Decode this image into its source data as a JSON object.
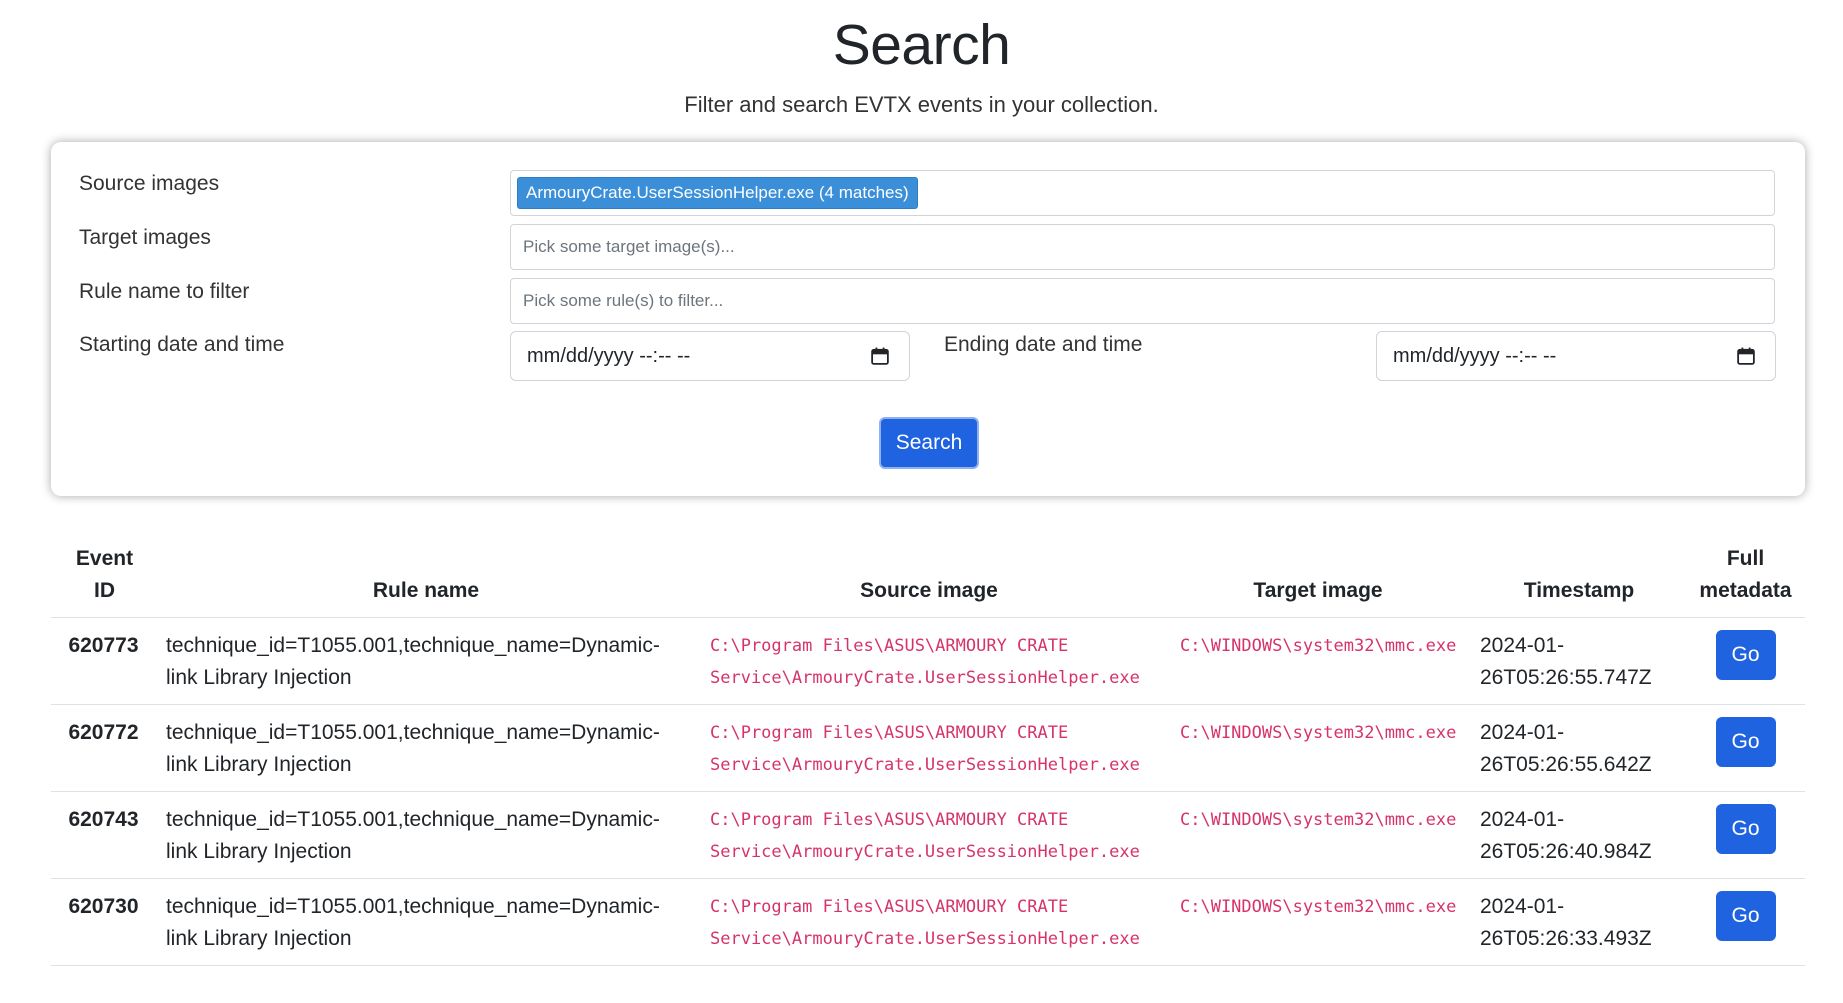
{
  "header": {
    "title": "Search",
    "subtitle": "Filter and search EVTX events in your collection."
  },
  "filters": {
    "source_images_label": "Source images",
    "source_images_selected": [
      "ArmouryCrate.UserSessionHelper.exe (4 matches)"
    ],
    "target_images_label": "Target images",
    "target_images_placeholder": "Pick some target image(s)...",
    "rule_name_label": "Rule name to filter",
    "rule_name_placeholder": "Pick some rule(s) to filter...",
    "start_label": "Starting date and time",
    "start_value": "mm/dd/yyyy --:-- --",
    "end_label": "Ending date and time",
    "end_value": "mm/dd/yyyy --:-- --",
    "search_button": "Search"
  },
  "table": {
    "headers": {
      "event_id_line1": "Event",
      "event_id_line2": "ID",
      "rule_name": "Rule name",
      "source_image": "Source image",
      "target_image": "Target image",
      "timestamp": "Timestamp",
      "metadata_line1": "Full",
      "metadata_line2": "metadata"
    },
    "rows": [
      {
        "event_id": "620773",
        "rule_name": "technique_id=T1055.001,technique_name=Dynamic-link Library Injection",
        "source_image": "C:\\Program Files\\ASUS\\ARMOURY CRATE Service\\ArmouryCrate.UserSessionHelper.exe",
        "target_image": "C:\\WINDOWS\\system32\\mmc.exe",
        "timestamp": "2024-01-26T05:26:55.747Z",
        "action": "Go"
      },
      {
        "event_id": "620772",
        "rule_name": "technique_id=T1055.001,technique_name=Dynamic-link Library Injection",
        "source_image": "C:\\Program Files\\ASUS\\ARMOURY CRATE Service\\ArmouryCrate.UserSessionHelper.exe",
        "target_image": "C:\\WINDOWS\\system32\\mmc.exe",
        "timestamp": "2024-01-26T05:26:55.642Z",
        "action": "Go"
      },
      {
        "event_id": "620743",
        "rule_name": "technique_id=T1055.001,technique_name=Dynamic-link Library Injection",
        "source_image": "C:\\Program Files\\ASUS\\ARMOURY CRATE Service\\ArmouryCrate.UserSessionHelper.exe",
        "target_image": "C:\\WINDOWS\\system32\\mmc.exe",
        "timestamp": "2024-01-26T05:26:40.984Z",
        "action": "Go"
      },
      {
        "event_id": "620730",
        "rule_name": "technique_id=T1055.001,technique_name=Dynamic-link Library Injection",
        "source_image": "C:\\Program Files\\ASUS\\ARMOURY CRATE Service\\ArmouryCrate.UserSessionHelper.exe",
        "target_image": "C:\\WINDOWS\\system32\\mmc.exe",
        "timestamp": "2024-01-26T05:26:33.493Z",
        "action": "Go"
      }
    ]
  },
  "colors": {
    "primary": "#1f63e0",
    "tag_bg": "#3a8fd8",
    "code_text": "#d6336c"
  },
  "icons": {
    "calendar": "calendar-icon"
  }
}
